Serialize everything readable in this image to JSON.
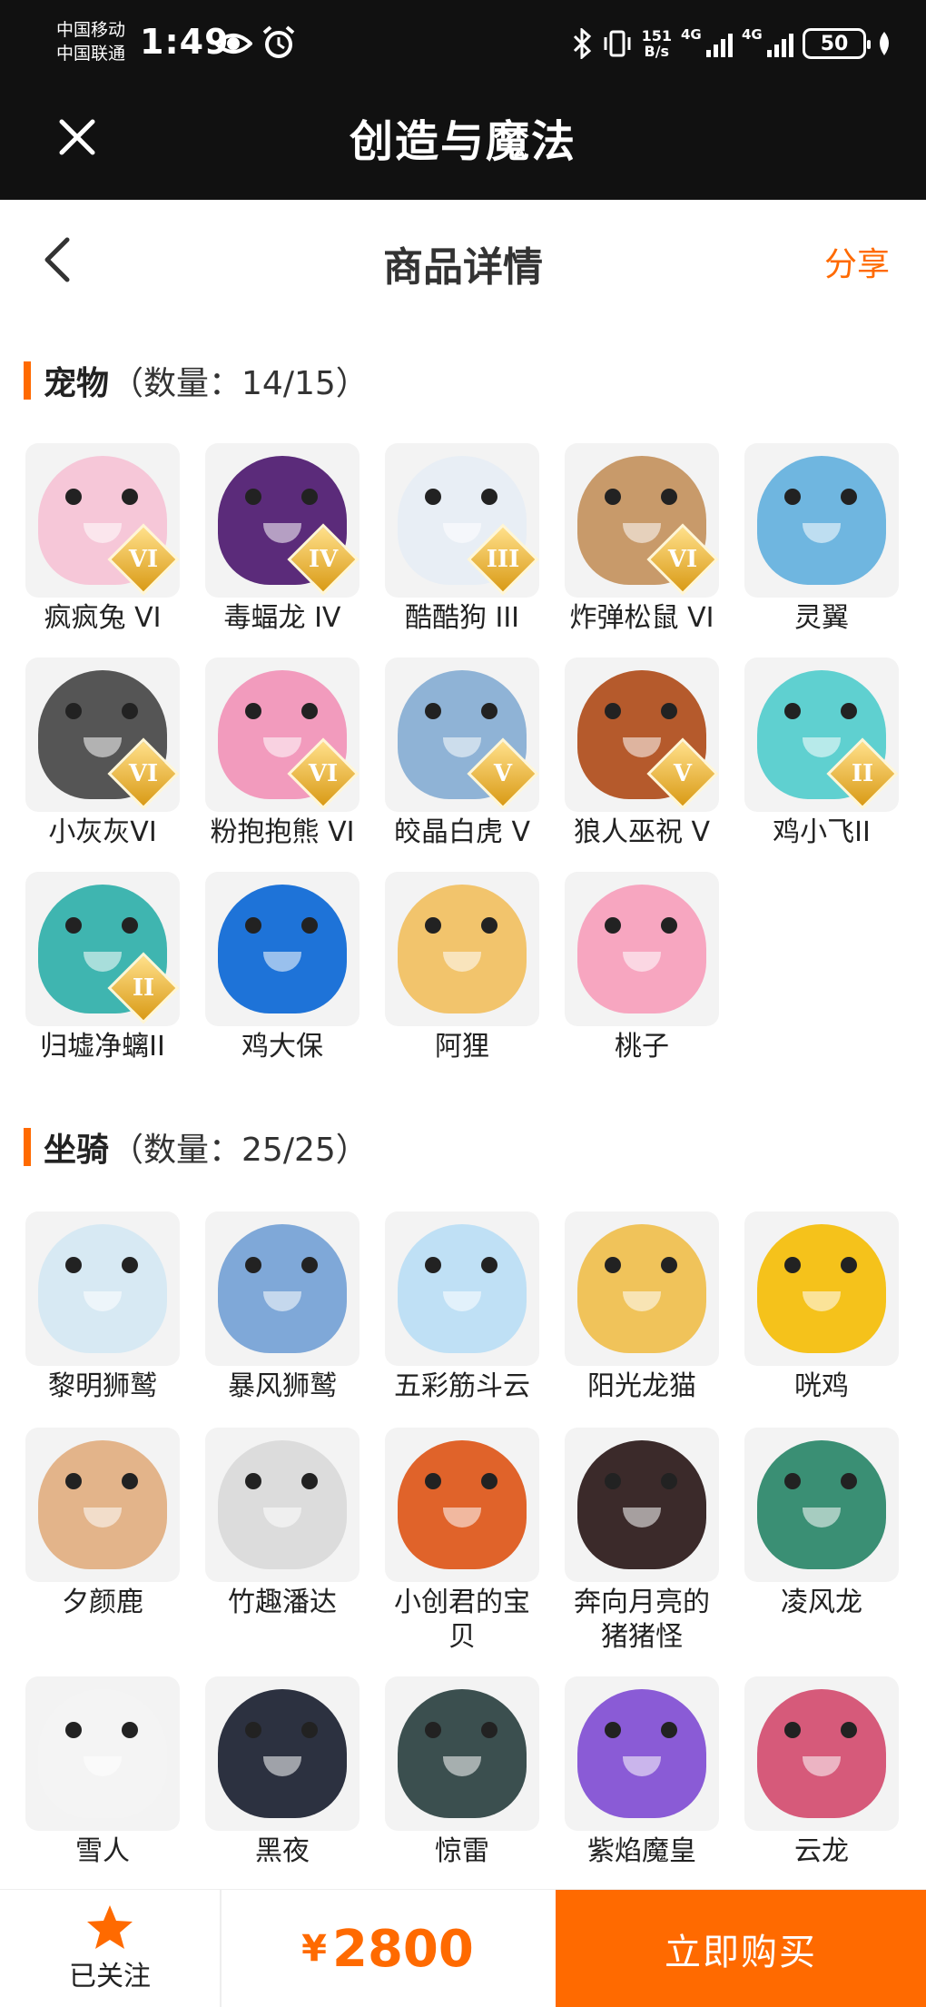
{
  "status_bar": {
    "carrier_1": "中国移动",
    "carrier_2": "中国联通",
    "time": "1:49",
    "net_speed_value": "151",
    "net_speed_unit": "B/s",
    "signal_1_type": "4G",
    "signal_2_type": "4G",
    "battery": "50",
    "icons": [
      "eye-icon",
      "alarm-icon",
      "bluetooth-icon",
      "vibrate-icon",
      "signal-icon",
      "battery-icon",
      "leaf-icon"
    ]
  },
  "app_bar": {
    "title": "创造与魔法",
    "close_icon": "close-icon"
  },
  "page_header": {
    "title": "商品详情",
    "share_label": "分享",
    "back_icon": "chevron-left-icon"
  },
  "pets": {
    "name": "宠物",
    "count": "（数量：14/15）",
    "items": [
      {
        "label": "疯疯兔 VI",
        "rank": "VI",
        "color": "#f6c7d8"
      },
      {
        "label": "毒蝠龙 IV",
        "rank": "IV",
        "color": "#5b2b7a"
      },
      {
        "label": "酷酷狗 III",
        "rank": "III",
        "color": "#e8eef5"
      },
      {
        "label": "炸弹松鼠 VI",
        "rank": "VI",
        "color": "#c89a6a"
      },
      {
        "label": "灵翼",
        "rank": "",
        "color": "#6fb6e0"
      },
      {
        "label": "小灰灰VI",
        "rank": "VI",
        "color": "#555555"
      },
      {
        "label": "粉抱抱熊 VI",
        "rank": "VI",
        "color": "#f29bbd"
      },
      {
        "label": "皎晶白虎 V",
        "rank": "V",
        "color": "#8fb3d6"
      },
      {
        "label": "狼人巫祝 V",
        "rank": "V",
        "color": "#b55a2c"
      },
      {
        "label": "鸡小飞II",
        "rank": "II",
        "color": "#5fd0d0"
      },
      {
        "label": "归墟净螭II",
        "rank": "II",
        "color": "#3fb5b0"
      },
      {
        "label": "鸡大保",
        "rank": "",
        "color": "#1e73d8"
      },
      {
        "label": "阿狸",
        "rank": "",
        "color": "#f2c46c"
      },
      {
        "label": "桃子",
        "rank": "",
        "color": "#f7a6c0"
      }
    ]
  },
  "mounts": {
    "name": "坐骑",
    "count": "（数量：25/25）",
    "items": [
      {
        "label": "黎明狮鹫",
        "rank": "",
        "color": "#d7e9f3"
      },
      {
        "label": "暴风狮鹫",
        "rank": "",
        "color": "#7fa8d8"
      },
      {
        "label": "五彩筋斗云",
        "rank": "",
        "color": "#bfe0f5"
      },
      {
        "label": "阳光龙猫",
        "rank": "",
        "color": "#f0c35a"
      },
      {
        "label": "咣鸡",
        "rank": "",
        "color": "#f5c21b"
      },
      {
        "label": "夕颜鹿",
        "rank": "",
        "color": "#e3b48a"
      },
      {
        "label": "竹趣潘达",
        "rank": "",
        "color": "#dcdcdc"
      },
      {
        "label": "小创君的宝贝",
        "rank": "",
        "color": "#e0632a"
      },
      {
        "label": "奔向月亮的猪猪怪",
        "rank": "",
        "color": "#3b2a2a"
      },
      {
        "label": "凌风龙",
        "rank": "",
        "color": "#3a8f74"
      },
      {
        "label": "雪人",
        "rank": "",
        "color": "#f4f4f4"
      },
      {
        "label": "黑夜",
        "rank": "",
        "color": "#2c3140"
      },
      {
        "label": "惊雷",
        "rank": "",
        "color": "#3b4f4f"
      },
      {
        "label": "紫焰魔皇",
        "rank": "",
        "color": "#8a5bd6"
      },
      {
        "label": "云龙",
        "rank": "",
        "color": "#d65a7a"
      }
    ]
  },
  "bottom_bar": {
    "follow_label": "已关注",
    "currency": "¥",
    "price": "2800",
    "buy_label": "立即购买",
    "accent": "#ff6a00"
  }
}
